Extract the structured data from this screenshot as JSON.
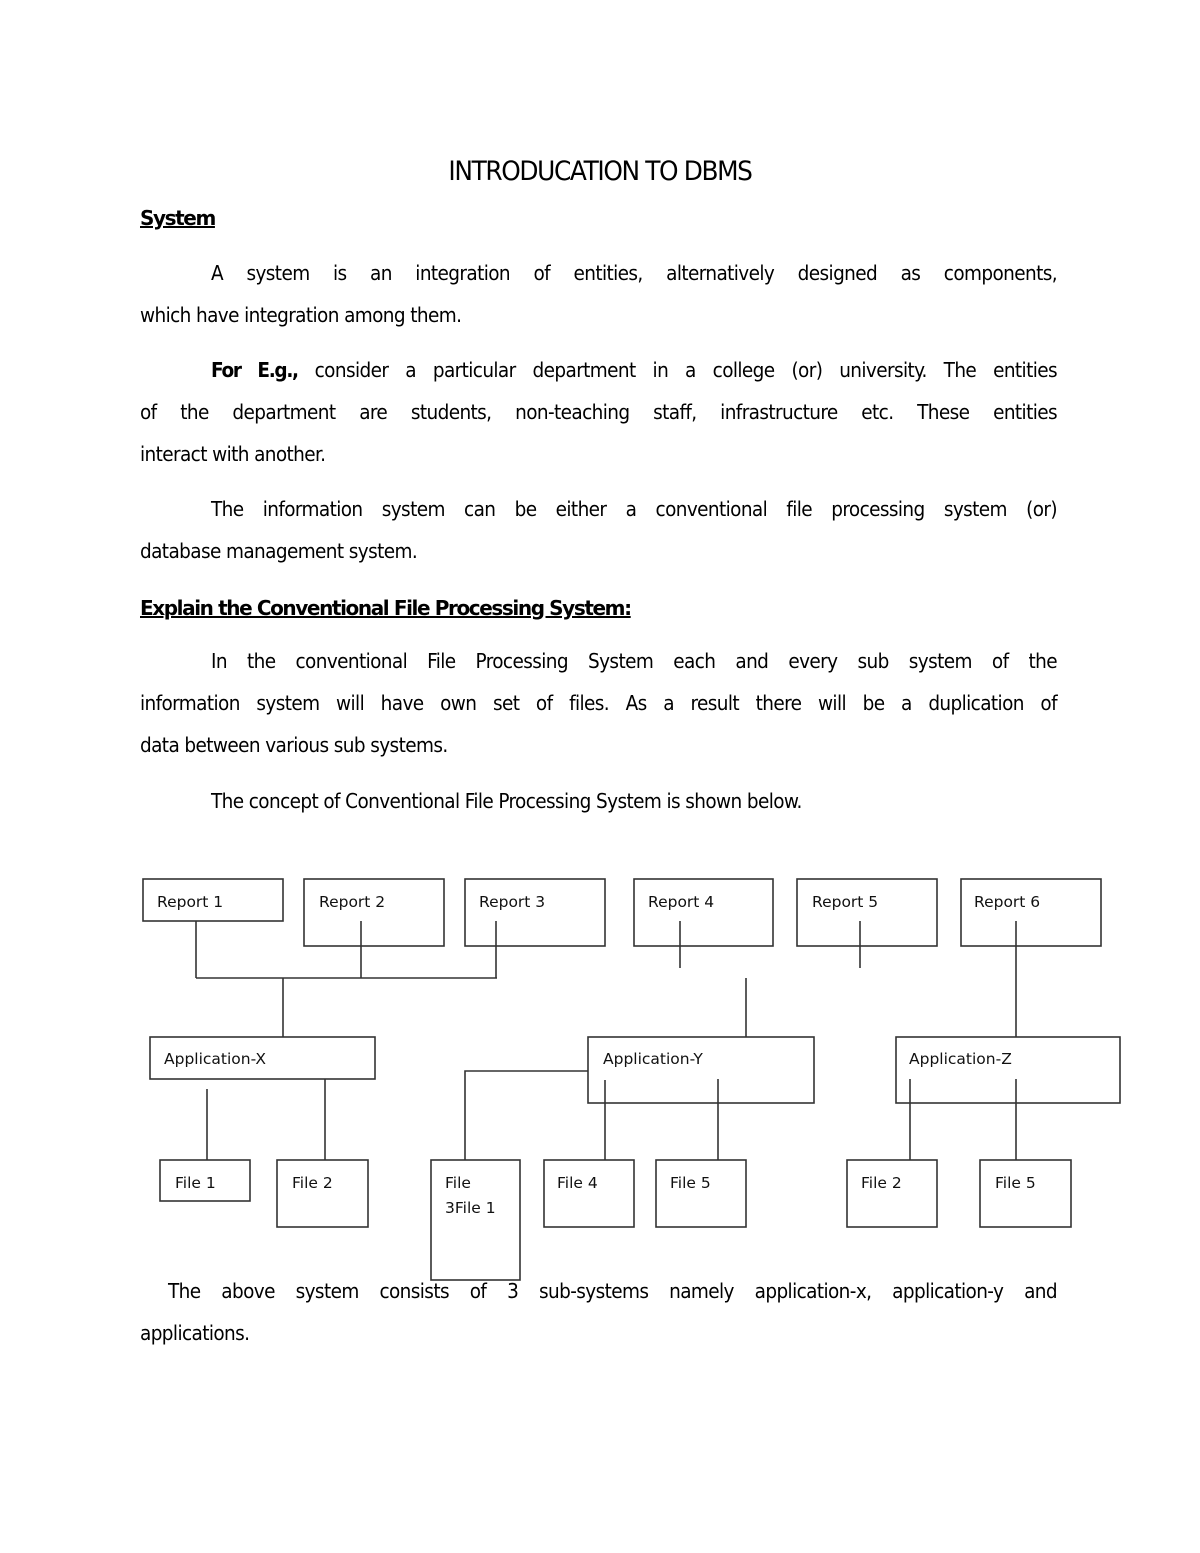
{
  "document": {
    "title": "INTRODUCATION TO DBMS",
    "sections": [
      {
        "heading": "System",
        "paragraphs": [
          [
            "A system is an integration of entities, alternatively designed as components,",
            "which have integration among them."
          ],
          [
            "consider a particular department in a college (or) university. The entities",
            "of the department are students, non-teaching staff, infrastructure etc. These entities",
            "interact with another."
          ],
          [
            "The information system can be either a conventional file processing system (or)",
            "database management system."
          ]
        ],
        "example_prefix": "For E.g.,"
      },
      {
        "heading": "Explain the Conventional File Processing System:",
        "paragraphs": [
          [
            "In the conventional File Processing System each and every sub system of the",
            "information system will have own set of files. As a result there will be a duplication of",
            "data between various sub systems."
          ],
          [
            "The concept of Conventional File Processing System is shown below."
          ]
        ]
      }
    ],
    "conclusion": [
      "The above system consists of 3 sub-systems namely application-x, application-y and",
      "applications."
    ]
  },
  "diagram": {
    "reports": [
      "Report 1",
      "Report 2",
      "Report 3",
      "Report 4",
      "Report 5",
      "Report 6"
    ],
    "applications": [
      "Application-X",
      "Application-Y",
      "Application-Z"
    ],
    "files": [
      {
        "label": [
          "File 1"
        ],
        "application": "Application-X"
      },
      {
        "label": [
          "File 2"
        ],
        "application": "Application-X"
      },
      {
        "label": [
          "File",
          "3File 1"
        ],
        "application": "Application-Y"
      },
      {
        "label": [
          "File 4"
        ],
        "application": "Application-Y"
      },
      {
        "label": [
          "File 5"
        ],
        "application": "Application-Y"
      },
      {
        "label": [
          "File 2"
        ],
        "application": "Application-Z"
      },
      {
        "label": [
          "File 5"
        ],
        "application": "Application-Z"
      }
    ]
  }
}
